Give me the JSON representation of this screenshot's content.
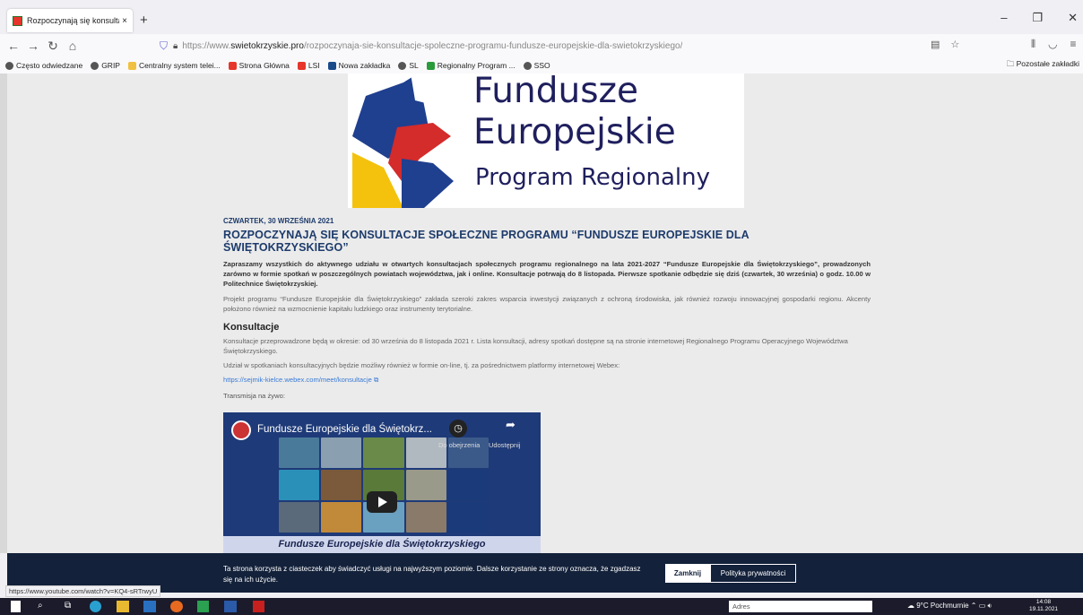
{
  "browser": {
    "tab_title": "Rozpoczynają się konsultacje sp",
    "tab_close": "×",
    "new_tab": "+",
    "url_prefix": "https://www.",
    "url_domain": "swietokrzyskie.pro",
    "url_path": "/rozpoczynaja-sie-konsultacje-spoleczne-programu-fundusze-europejskie-dla-swietokrzyskiego/",
    "status_url": "https://www.youtube.com/watch?v=KQ4-sRTrwyU"
  },
  "bookmarks": [
    {
      "label": "Często odwiedzane",
      "icon": "gear-icon",
      "color": "#555555"
    },
    {
      "label": "GRIP",
      "icon": "globe-icon",
      "color": "#555555"
    },
    {
      "label": "Centralny system telei...",
      "icon": "page-icon",
      "color": "#f0c040"
    },
    {
      "label": "Strona Główna",
      "icon": "crest-icon",
      "color": "#e6352b"
    },
    {
      "label": "LSI",
      "icon": "crest-icon",
      "color": "#e6352b"
    },
    {
      "label": "Nowa zakładka",
      "icon": "image-icon",
      "color": "#1a4a8a"
    },
    {
      "label": "SL",
      "icon": "globe-icon",
      "color": "#555555"
    },
    {
      "label": "Regionalny Program ...",
      "icon": "flag-icon",
      "color": "#2a9a3a"
    },
    {
      "label": "SSO",
      "icon": "globe-icon",
      "color": "#555555"
    }
  ],
  "bookmarks_other": "Pozostałe zakładki",
  "logo": {
    "line1": "Fundusze",
    "line2": "Europejskie",
    "line3": "Program Regionalny"
  },
  "article": {
    "date": "CZWARTEK, 30 WRZEŚNIA 2021",
    "title": "ROZPOCZYNAJĄ SIĘ KONSULTACJE SPOŁECZNE PROGRAMU “FUNDUSZE EUROPEJSKIE DLA ŚWIĘTOKRZYSKIEGO”",
    "lead": "Zapraszamy wszystkich do aktywnego udziału w otwartych konsultacjach społecznych programu regionalnego na lata 2021-2027 “Fundusze Europejskie dla Świętokrzyskiego”, prowadzonych zarówno w formie spotkań w poszczególnych powiatach województwa, jak i online. Konsultacje potrwają do 8 listopada. Pierwsze spotkanie odbędzie się dziś (czwartek, 30 września) o godz. 10.00 w Politechnice Świętokrzyskiej.",
    "p1": "Projekt programu “Fundusze Europejskie dla Świętokrzyskiego” zakłada szeroki zakres wsparcia inwestycji związanych z ochroną środowiska, jak również rozwoju innowacyjnej gospodarki regionu. Akcenty położono również na wzmocnienie kapitału ludzkiego oraz instrumenty terytorialne.",
    "h2": "Konsultacje",
    "p2": "Konsultacje przeprowadzone będą w okresie: od 30 września do 8 listopada 2021 r. Lista konsultacji, adresy spotkań dostępne są na stronie internetowej Regionalnego Programu Operacyjnego Województwa Świętokrzyskiego.",
    "p3": "Udział w spotkaniach konsultacyjnych będzie możliwy również w formie on-line, tj. za pośrednictwem platformy internetowej Webex:",
    "link": "https://sejmik-kielce.webex.com/meet/konsultacje",
    "live": "Transmisja na żywo:"
  },
  "video": {
    "title": "Fundusze Europejskie dla Świętokrz...",
    "later": "Do obejrzenia",
    "share": "Udostępnij",
    "caption": "Fundusze Europejskie dla Świętokrzyskiego"
  },
  "cookie": {
    "text": "Ta strona korzysta z ciasteczek aby świadczyć usługi na najwyższym poziomie. Dalsze korzystanie ze strony oznacza, że zgadzasz się na ich użycie.",
    "close": "Zamknij",
    "privacy": "Polityka prywatności"
  },
  "taskbar": {
    "search_label": "Adres",
    "weather": "9°C Pochmurnie",
    "time": "14:08",
    "date": "19.11.2021"
  }
}
